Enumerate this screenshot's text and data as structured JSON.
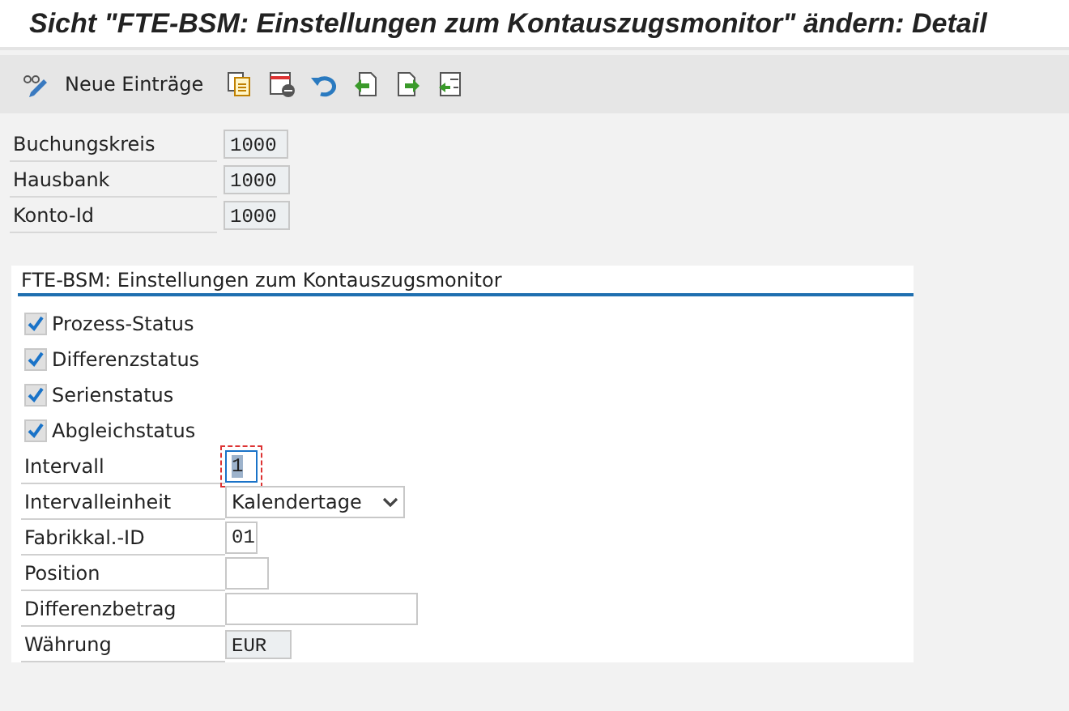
{
  "window": {
    "title": "Sicht \"FTE-BSM: Einstellungen zum Kontauszugsmonitor\" ändern: Detail"
  },
  "toolbar": {
    "items": [
      {
        "kind": "edit",
        "label": "Neue Einträge"
      },
      {
        "kind": "copy"
      },
      {
        "kind": "delete"
      },
      {
        "kind": "undo"
      },
      {
        "kind": "prev"
      },
      {
        "kind": "next"
      },
      {
        "kind": "select"
      }
    ]
  },
  "keys": [
    {
      "label": "Buchungskreis",
      "value": "1000"
    },
    {
      "label": "Hausbank",
      "value": "1000"
    },
    {
      "label": "Konto-Id",
      "value": "1000"
    }
  ],
  "group": {
    "title": "FTE-BSM: Einstellungen zum Kontauszugsmonitor",
    "fields": [
      {
        "kind": "checkbox",
        "label": "Prozess-Status",
        "checked": true
      },
      {
        "kind": "checkbox",
        "label": "Differenzstatus",
        "checked": true
      },
      {
        "kind": "checkbox",
        "label": "Serienstatus",
        "checked": true
      },
      {
        "kind": "checkbox",
        "label": "Abgleichstatus",
        "checked": true
      },
      {
        "kind": "input",
        "label": "Intervall",
        "value": "1",
        "focused": true
      },
      {
        "kind": "select",
        "label": "Intervalleinheit",
        "value": "Kalendertage"
      },
      {
        "kind": "input",
        "label": "Fabrikkal.-ID",
        "value": "01"
      },
      {
        "kind": "input",
        "label": "Position"
      },
      {
        "kind": "input",
        "label": "Differenzbetrag"
      },
      {
        "kind": "readonly",
        "label": "Währung",
        "value": "EUR"
      }
    ]
  }
}
